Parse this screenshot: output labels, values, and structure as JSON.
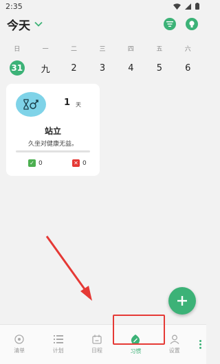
{
  "status_bar": {
    "time": "2:35"
  },
  "header": {
    "title": "今天"
  },
  "calendar": {
    "weekdays": [
      "日",
      "一",
      "二",
      "三",
      "四",
      "五",
      "六"
    ],
    "dates": [
      "31",
      "九",
      "2",
      "3",
      "4",
      "5",
      "6"
    ],
    "selected_index": 0
  },
  "habit_card": {
    "days_count": "1",
    "days_unit": "天",
    "name": "站立",
    "description": "久坐对健康无益。",
    "progress": 0,
    "done_count": "0",
    "fail_count": "0"
  },
  "bottom_nav": {
    "items": [
      {
        "label": "清单",
        "icon": "target-icon"
      },
      {
        "label": "计划",
        "icon": "list-icon"
      },
      {
        "label": "日程",
        "icon": "calendar-icon"
      },
      {
        "label": "习惯",
        "icon": "habit-leaf-icon"
      },
      {
        "label": "设置",
        "icon": "person-icon"
      }
    ],
    "active_index": 3
  },
  "colors": {
    "accent": "#3cb277",
    "habit_icon_bg": "#7fd3e8",
    "annotation": "#e53935"
  }
}
